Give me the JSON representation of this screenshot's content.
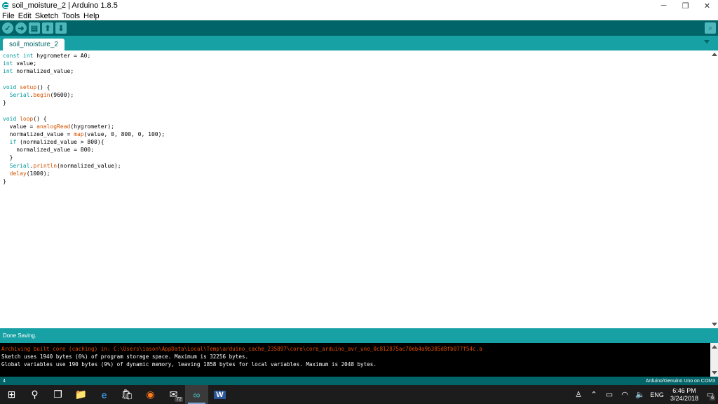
{
  "window": {
    "title": "soil_moisture_2 | Arduino 1.8.5",
    "controls": {
      "minimize": "─",
      "maximize": "❐",
      "close": "✕"
    }
  },
  "menu": [
    "File",
    "Edit",
    "Sketch",
    "Tools",
    "Help"
  ],
  "toolbar": {
    "verify_glyph": "✓",
    "upload_glyph": "➜",
    "new_glyph": "▤",
    "open_glyph": "⬆",
    "save_glyph": "⬇",
    "serial_glyph": "⌕"
  },
  "tab": {
    "label": "soil_moisture_2"
  },
  "editor": {
    "lines": [
      "const int hygrometer = A0;",
      "int value;",
      "int normalized_value;",
      "",
      "void setup() {",
      "  Serial.begin(9600);",
      "}",
      "",
      "void loop() {",
      "  value = analogRead(hygrometer);",
      "  normalized_value = map(value, 0, 800, 0, 100);",
      "  if (normalized_value > 800){",
      "    normalized_value = 800;",
      "  }",
      "  Serial.println(normalized_value);",
      "  delay(1000);",
      "}"
    ]
  },
  "status": {
    "message": "Done Saving."
  },
  "console": {
    "lines": [
      {
        "text": "Archiving built core (caching) in: C:\\Users\\iason\\AppData\\Local\\Temp\\arduino_cache_235897\\core\\core_arduino_avr_uno_0c812875ac70eb4a9b385d8fb077f54c.a",
        "type": "err"
      },
      {
        "text": "Sketch uses 1940 bytes (6%) of program storage space. Maximum is 32256 bytes.",
        "type": "normal"
      },
      {
        "text": "Global variables use 190 bytes (9%) of dynamic memory, leaving 1858 bytes for local variables. Maximum is 2048 bytes.",
        "type": "normal"
      }
    ]
  },
  "footer": {
    "line_number": "4",
    "board": "Arduino/Genuino Uno on COM3"
  },
  "taskbar": {
    "apps": [
      {
        "name": "start-icon",
        "glyph": "⊞"
      },
      {
        "name": "search-icon",
        "glyph": "⚲"
      },
      {
        "name": "task-view-icon",
        "glyph": "❐"
      },
      {
        "name": "file-explorer-icon",
        "glyph": "📁"
      },
      {
        "name": "edge-icon",
        "glyph": "e"
      },
      {
        "name": "store-icon",
        "glyph": "🛍"
      },
      {
        "name": "firefox-icon",
        "glyph": "◉"
      },
      {
        "name": "mail-icon",
        "glyph": "✉"
      },
      {
        "name": "arduino-icon",
        "glyph": "∞"
      },
      {
        "name": "word-icon",
        "glyph": "W"
      }
    ],
    "mail_badge": "72",
    "tray": {
      "language": "ENG",
      "time": "6:46 PM",
      "date": "3/24/2018",
      "notifications": "6"
    }
  }
}
